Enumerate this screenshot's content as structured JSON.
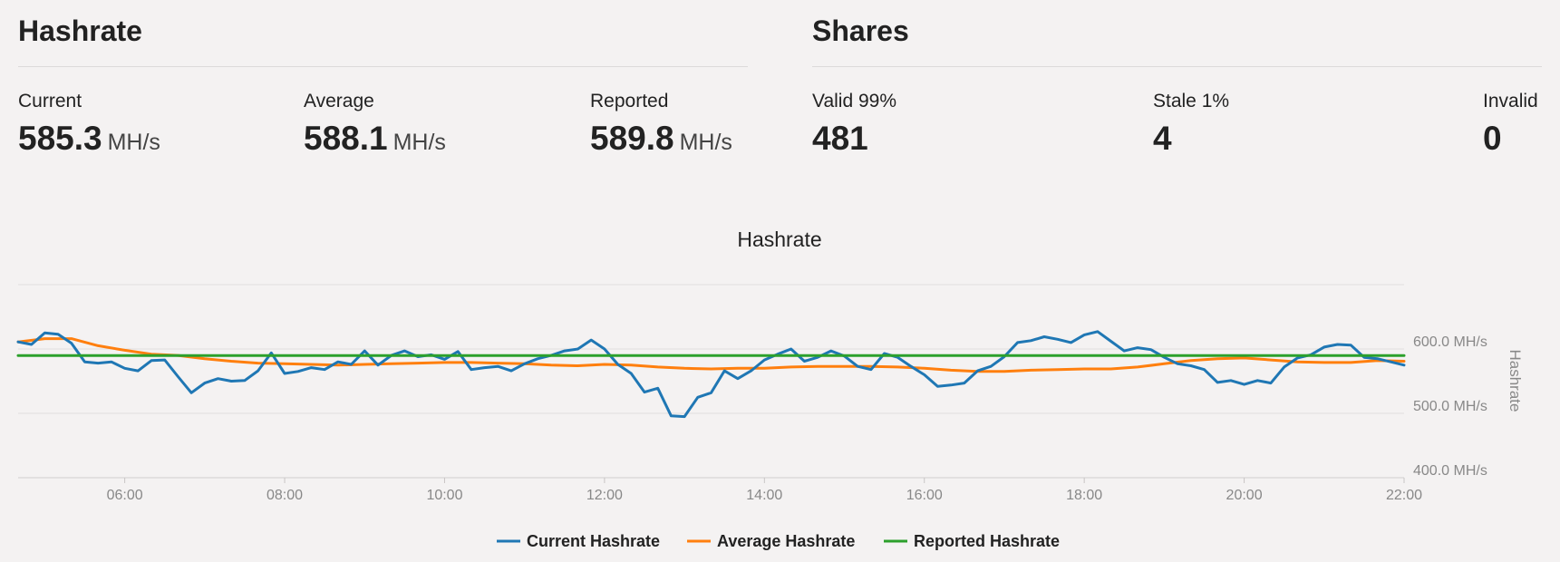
{
  "hashrate": {
    "title": "Hashrate",
    "stats": [
      {
        "label": "Current",
        "value": "585.3",
        "unit": "MH/s"
      },
      {
        "label": "Average",
        "value": "588.1",
        "unit": "MH/s"
      },
      {
        "label": "Reported",
        "value": "589.8",
        "unit": "MH/s"
      }
    ]
  },
  "shares": {
    "title": "Shares",
    "stats": [
      {
        "label": "Valid 99%",
        "value": "481"
      },
      {
        "label": "Stale 1%",
        "value": "4"
      },
      {
        "label": "Invalid",
        "value": "0"
      }
    ]
  },
  "chart_data": {
    "type": "line",
    "title": "Hashrate",
    "ylabel": "Hashrate",
    "xlabel": "",
    "xlim": [
      "04:40",
      "22:00"
    ],
    "ylim": [
      400,
      700
    ],
    "y_ticks": [
      400,
      500,
      600
    ],
    "y_tick_labels": [
      "400.0 MH/s",
      "500.0 MH/s",
      "600.0 MH/s"
    ],
    "x_ticks": [
      "06:00",
      "08:00",
      "10:00",
      "12:00",
      "14:00",
      "16:00",
      "18:00",
      "20:00",
      "22:00"
    ],
    "grid": true,
    "legend_position": "bottom",
    "colors": {
      "current": "#1f77b4",
      "average": "#ff7f0e",
      "reported": "#2ca02c"
    },
    "series": [
      {
        "name": "Current Hashrate",
        "color": "#1f77b4",
        "x": [
          "04:40",
          "04:50",
          "05:00",
          "05:10",
          "05:20",
          "05:30",
          "05:40",
          "05:50",
          "06:00",
          "06:10",
          "06:20",
          "06:30",
          "06:40",
          "06:50",
          "07:00",
          "07:10",
          "07:20",
          "07:30",
          "07:40",
          "07:50",
          "08:00",
          "08:10",
          "08:20",
          "08:30",
          "08:40",
          "08:50",
          "09:00",
          "09:10",
          "09:20",
          "09:30",
          "09:40",
          "09:50",
          "10:00",
          "10:10",
          "10:20",
          "10:30",
          "10:40",
          "10:50",
          "11:00",
          "11:10",
          "11:20",
          "11:30",
          "11:40",
          "11:50",
          "12:00",
          "12:10",
          "12:20",
          "12:30",
          "12:40",
          "12:50",
          "13:00",
          "13:10",
          "13:20",
          "13:30",
          "13:40",
          "13:50",
          "14:00",
          "14:10",
          "14:20",
          "14:30",
          "14:40",
          "14:50",
          "15:00",
          "15:10",
          "15:20",
          "15:30",
          "15:40",
          "15:50",
          "16:00",
          "16:10",
          "16:20",
          "16:30",
          "16:40",
          "16:50",
          "17:00",
          "17:10",
          "17:20",
          "17:30",
          "17:40",
          "17:50",
          "18:00",
          "18:10",
          "18:20",
          "18:30",
          "18:40",
          "18:50",
          "19:00",
          "19:10",
          "19:20",
          "19:30",
          "19:40",
          "19:50",
          "20:00",
          "20:10",
          "20:20",
          "20:30",
          "20:40",
          "20:50",
          "21:00",
          "21:10",
          "21:20",
          "21:30",
          "21:40",
          "21:50",
          "22:00"
        ],
        "values": [
          611,
          607,
          625,
          623,
          609,
          580,
          578,
          580,
          570,
          566,
          582,
          583,
          557,
          532,
          547,
          554,
          550,
          551,
          566,
          594,
          562,
          565,
          571,
          568,
          580,
          576,
          597,
          575,
          590,
          597,
          588,
          591,
          584,
          596,
          568,
          571,
          573,
          566,
          577,
          585,
          590,
          597,
          600,
          614,
          600,
          576,
          562,
          533,
          539,
          496,
          495,
          525,
          532,
          566,
          554,
          566,
          583,
          592,
          600,
          581,
          587,
          597,
          589,
          573,
          568,
          593,
          587,
          573,
          560,
          542,
          544,
          547,
          566,
          573,
          588,
          610,
          613,
          619,
          615,
          610,
          622,
          627,
          612,
          597,
          602,
          599,
          587,
          577,
          574,
          568,
          548,
          551,
          545,
          551,
          547,
          572,
          586,
          591,
          603,
          607,
          606,
          587,
          585,
          580,
          575
        ]
      },
      {
        "name": "Average Hashrate",
        "color": "#ff7f0e",
        "x": [
          "04:40",
          "05:00",
          "05:20",
          "05:40",
          "06:00",
          "06:20",
          "06:40",
          "07:00",
          "07:20",
          "07:40",
          "08:00",
          "08:20",
          "08:40",
          "09:00",
          "09:20",
          "09:40",
          "10:00",
          "10:20",
          "10:40",
          "11:00",
          "11:20",
          "11:40",
          "12:00",
          "12:20",
          "12:40",
          "13:00",
          "13:20",
          "13:40",
          "14:00",
          "14:20",
          "14:40",
          "15:00",
          "15:20",
          "15:40",
          "16:00",
          "16:20",
          "16:40",
          "17:00",
          "17:20",
          "17:40",
          "18:00",
          "18:20",
          "18:40",
          "19:00",
          "19:20",
          "19:40",
          "20:00",
          "20:20",
          "20:40",
          "21:00",
          "21:20",
          "21:40",
          "22:00"
        ],
        "values": [
          611,
          616,
          616,
          605,
          598,
          592,
          590,
          585,
          581,
          578,
          577,
          576,
          575,
          576,
          577,
          578,
          579,
          579,
          578,
          577,
          575,
          574,
          576,
          575,
          572,
          570,
          569,
          570,
          570,
          572,
          573,
          573,
          573,
          572,
          570,
          567,
          565,
          565,
          567,
          568,
          569,
          569,
          572,
          577,
          582,
          585,
          586,
          583,
          580,
          579,
          579,
          582,
          581
        ]
      },
      {
        "name": "Reported Hashrate",
        "color": "#2ca02c",
        "x": [
          "04:40",
          "22:00"
        ],
        "values": [
          589.8,
          589.8
        ]
      }
    ]
  }
}
